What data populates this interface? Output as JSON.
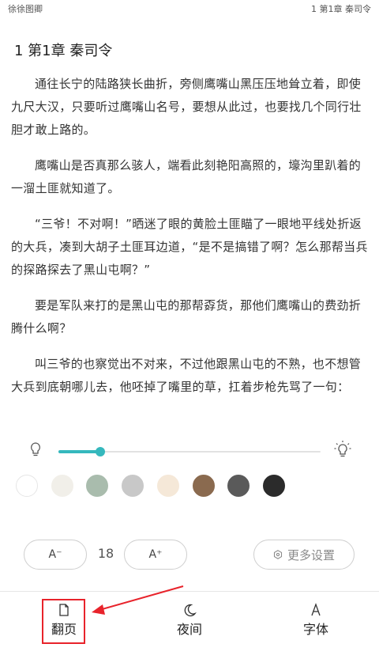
{
  "status_bar": {
    "book_name": "徐徐图卿",
    "chapter_indicator": "1 第1章 秦司令"
  },
  "chapter": {
    "title": "1 第1章 秦司令",
    "paragraphs": [
      "通往长宁的陆路狭长曲折，旁侧鹰嘴山黑压压地耸立着，即使九尺大汉，只要听过鹰嘴山名号，要想从此过，也要找几个同行壮胆才敢上路的。",
      "鹰嘴山是否真那么骇人，端看此刻艳阳高照的，壕沟里趴着的一溜土匪就知道了。",
      "“三爷！不对啊！”晒迷了眼的黄脸土匪瞄了一眼地平线处折返的大兵，凑到大胡子土匪耳边道，“是不是搞错了啊？怎么那帮当兵的探路探去了黑山屯啊？”",
      "要是军队来打的是黑山屯的那帮孬货，那他们鹰嘴山的费劲折腾什么啊？",
      "叫三爷的也察觉出不对来，不过他跟黑山屯的不熟，也不想管大兵到底朝哪儿去，他呸掉了嘴里的草，扛着步枪先骂了一句："
    ]
  },
  "settings": {
    "brightness": {
      "value": 0.16,
      "low_icon": "bulb-dim-icon",
      "high_icon": "bulb-bright-icon",
      "accent": "#35b8bd"
    },
    "background_colors": [
      "#ffffff",
      "#f1efe9",
      "#a9bcad",
      "#c8c8c8",
      "#f5e8d8",
      "#8a6a4f",
      "#5a5a5a",
      "#2b2b2b"
    ],
    "font_size": {
      "decrease_label": "A⁻",
      "value": "18",
      "increase_label": "A⁺"
    },
    "more_settings_label": "更多设置",
    "more_settings_icon": "hexagon-gear-icon"
  },
  "nav": {
    "items": [
      {
        "label": "翻页",
        "icon": "page-turn-icon",
        "highlighted": true
      },
      {
        "label": "夜间",
        "icon": "moon-icon"
      },
      {
        "label": "字体",
        "icon": "font-a-icon"
      }
    ],
    "highlight_color": "#e8232b"
  }
}
